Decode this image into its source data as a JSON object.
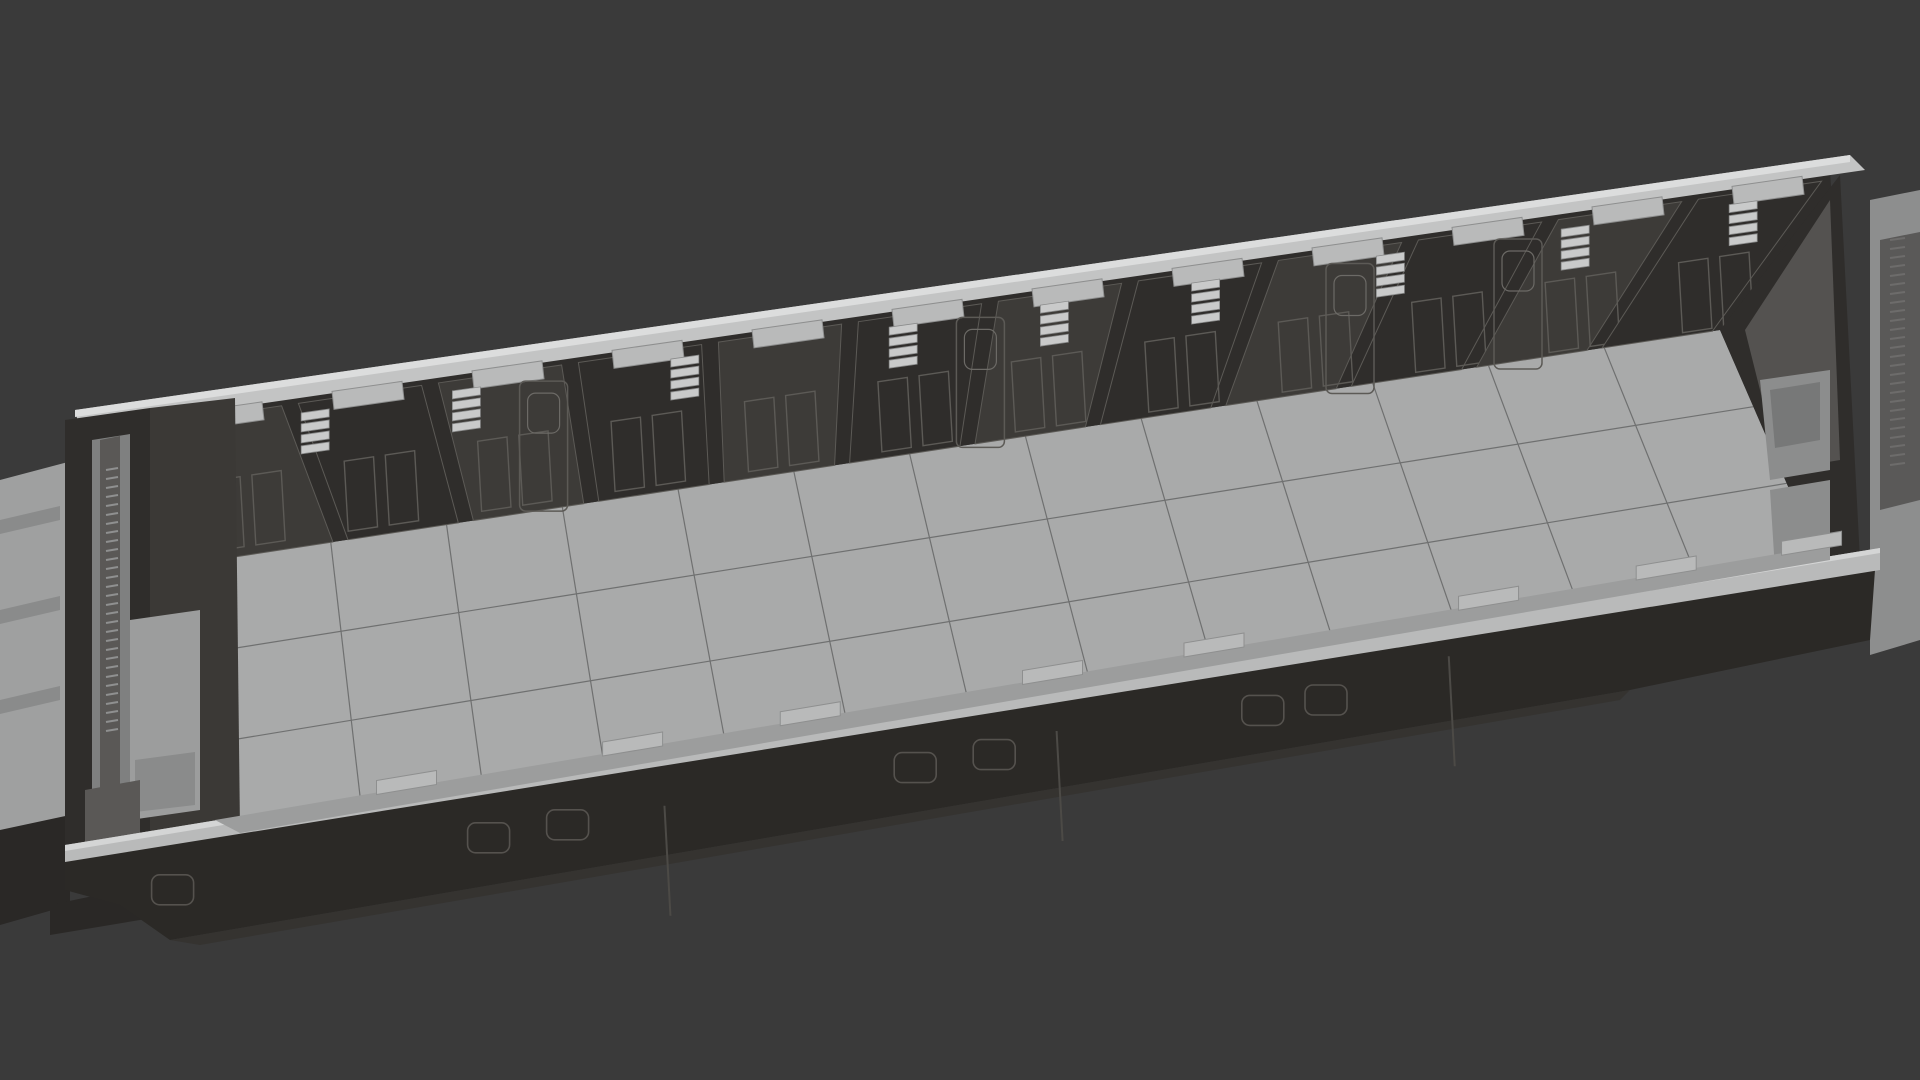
{
  "viewport": {
    "background": "#3a3a3a",
    "mode": "3d-viewport-solid-shading"
  },
  "model": {
    "description_key": "sci-fi-corridor-module",
    "colors": {
      "floor": "#a9aaaa",
      "floor_line": "#6f7070",
      "wall_top": "#b9baba",
      "wall_top_edge": "#d4d5d5",
      "wall_dark": "#2f2d2b",
      "wall_dark_light": "#3d3b38",
      "wall_outer": "#2b2926",
      "trim": "#8e8f8f",
      "panel_line": "#5c5a56",
      "greeble": "#c9caca",
      "bg_plate": "#444545"
    }
  }
}
